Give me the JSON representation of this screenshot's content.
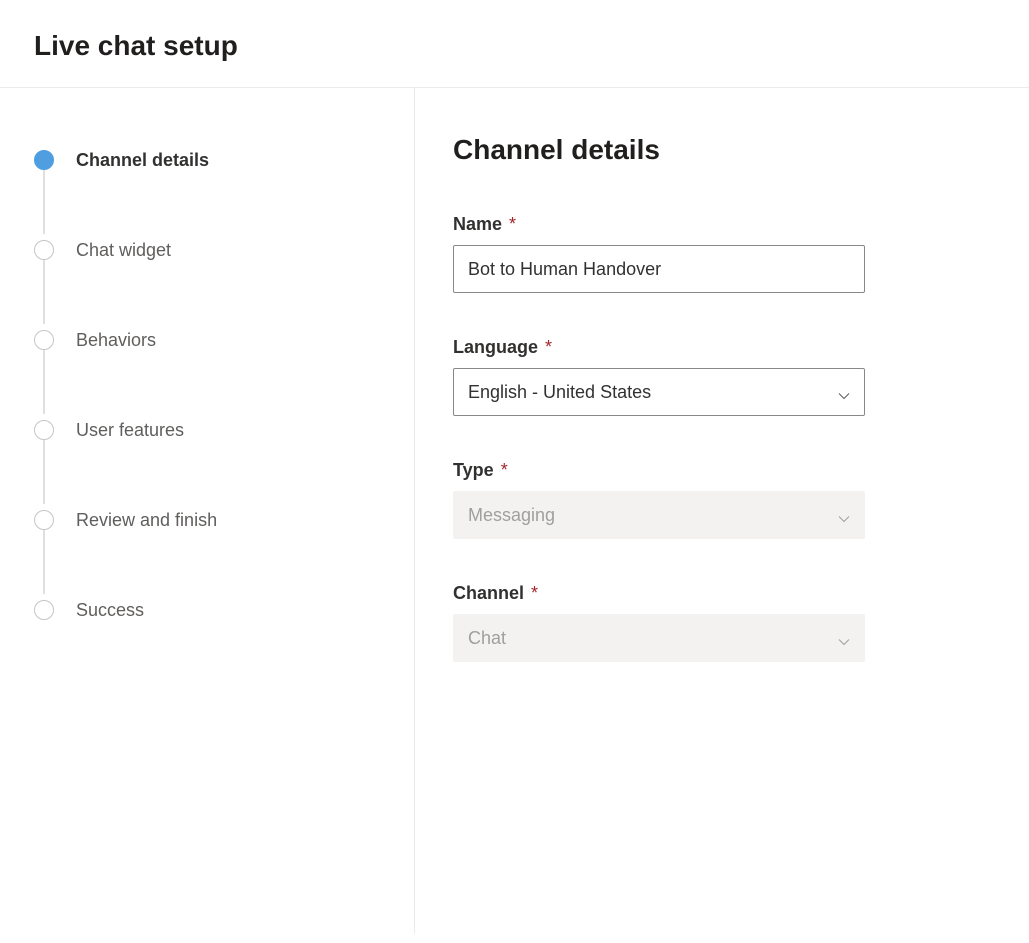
{
  "header": {
    "title": "Live chat setup"
  },
  "steps": [
    {
      "label": "Channel details",
      "active": true
    },
    {
      "label": "Chat widget",
      "active": false
    },
    {
      "label": "Behaviors",
      "active": false
    },
    {
      "label": "User features",
      "active": false
    },
    {
      "label": "Review and finish",
      "active": false
    },
    {
      "label": "Success",
      "active": false
    }
  ],
  "main": {
    "title": "Channel details",
    "fields": {
      "name": {
        "label": "Name",
        "required": "*",
        "value": "Bot to Human Handover"
      },
      "language": {
        "label": "Language",
        "required": "*",
        "value": "English - United States"
      },
      "type": {
        "label": "Type",
        "required": "*",
        "value": "Messaging"
      },
      "channel": {
        "label": "Channel",
        "required": "*",
        "value": "Chat"
      }
    }
  }
}
